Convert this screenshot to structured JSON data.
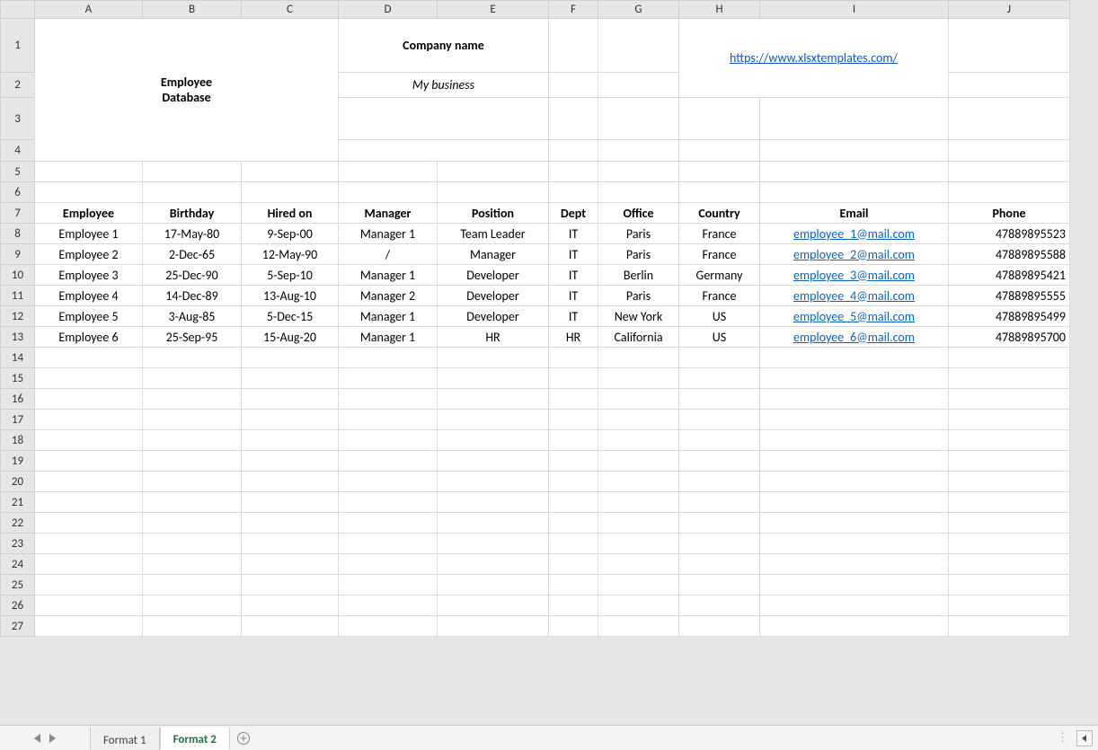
{
  "columns": [
    "A",
    "B",
    "C",
    "D",
    "E",
    "F",
    "G",
    "H",
    "I",
    "J"
  ],
  "rows": [
    1,
    2,
    3,
    4,
    5,
    6,
    7,
    8,
    9,
    10,
    11,
    12,
    13,
    14,
    15,
    16,
    17,
    18,
    19,
    20,
    21,
    22,
    23,
    24,
    25,
    26,
    27
  ],
  "title_line1": "Employee",
  "title_line2": "Database",
  "company_label": "Company name",
  "company_value": "My business",
  "external_link": "https://www.xlsxtemplates.com/",
  "headers": {
    "employee": "Employee",
    "birthday": "Birthday",
    "hired_on": "Hired on",
    "manager": "Manager",
    "position": "Position",
    "dept": "Dept",
    "office": "Office",
    "country": "Country",
    "email": "Email",
    "phone": "Phone"
  },
  "employees": [
    {
      "name": "Employee 1",
      "birthday": "17-May-80",
      "hired": "9-Sep-00",
      "manager": "Manager 1",
      "position": "Team Leader",
      "dept": "IT",
      "office": "Paris",
      "country": "France",
      "email": "employee_1@mail.com",
      "phone": "47889895523"
    },
    {
      "name": "Employee 2",
      "birthday": "2-Dec-65",
      "hired": "12-May-90",
      "manager": "/",
      "position": "Manager",
      "dept": "IT",
      "office": "Paris",
      "country": "France",
      "email": "employee_2@mail.com",
      "phone": "47889895588"
    },
    {
      "name": "Employee 3",
      "birthday": "25-Dec-90",
      "hired": "5-Sep-10",
      "manager": "Manager 1",
      "position": "Developer",
      "dept": "IT",
      "office": "Berlin",
      "country": "Germany",
      "email": "employee_3@mail.com",
      "phone": "47889895421"
    },
    {
      "name": "Employee 4",
      "birthday": "14-Dec-89",
      "hired": "13-Aug-10",
      "manager": "Manager 2",
      "position": "Developer",
      "dept": "IT",
      "office": "Paris",
      "country": "France",
      "email": "employee_4@mail.com",
      "phone": "47889895555"
    },
    {
      "name": "Employee 5",
      "birthday": "3-Aug-85",
      "hired": "5-Dec-15",
      "manager": "Manager 1",
      "position": "Developer",
      "dept": "IT",
      "office": "New York",
      "country": "US",
      "email": "employee_5@mail.com",
      "phone": "47889895499"
    },
    {
      "name": "Employee 6",
      "birthday": "25-Sep-95",
      "hired": "15-Aug-20",
      "manager": "Manager 1",
      "position": "HR",
      "dept": "HR",
      "office": "California",
      "country": "US",
      "email": "employee_6@mail.com",
      "phone": "47889895700"
    }
  ],
  "tabs": {
    "tab1": "Format 1",
    "tab2": "Format 2"
  }
}
